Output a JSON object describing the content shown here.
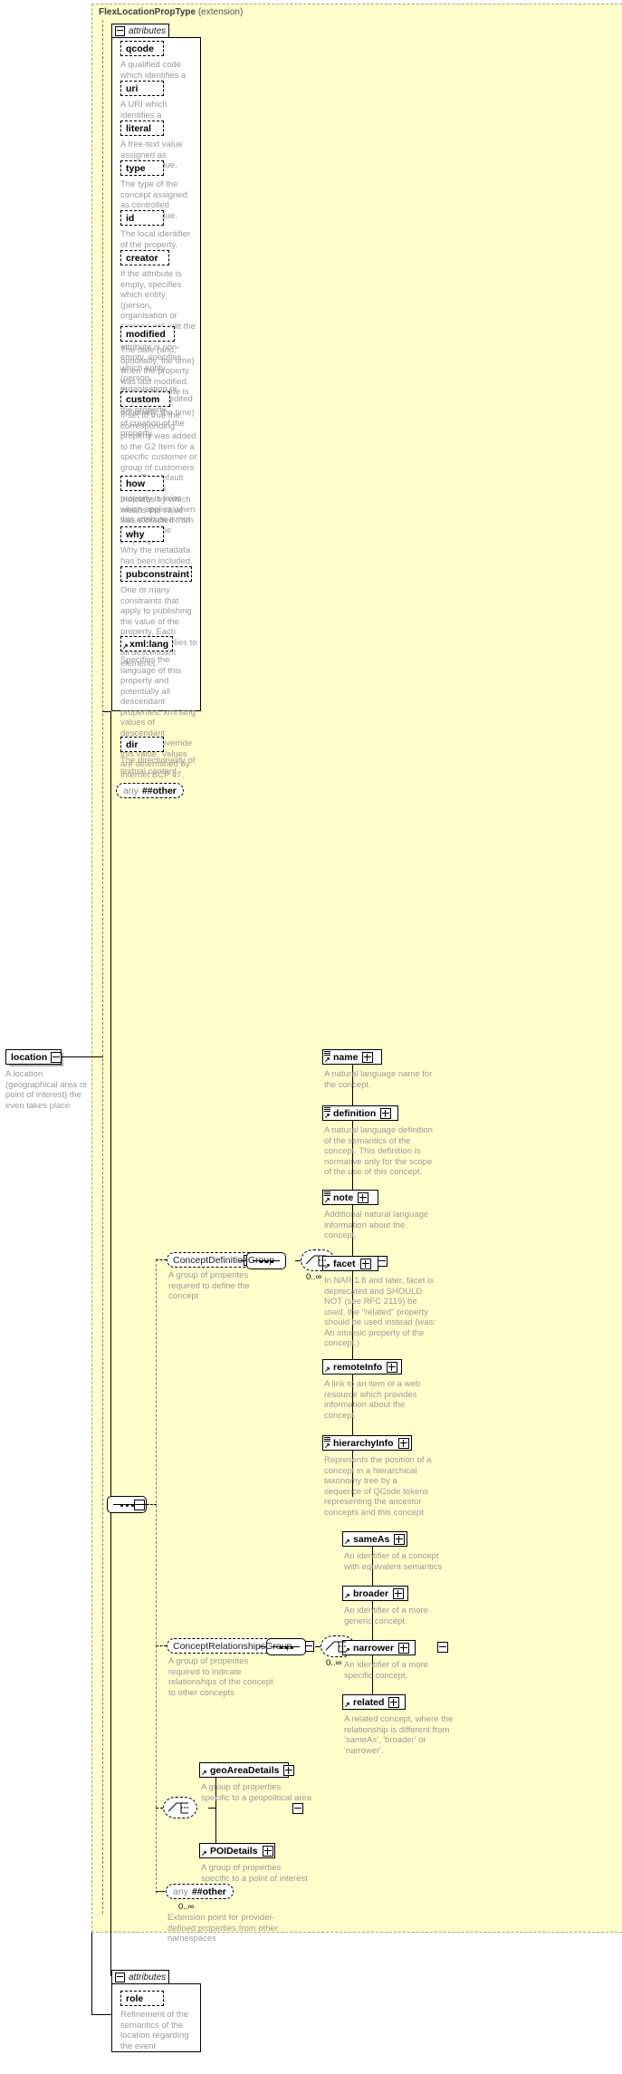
{
  "diagram": {
    "type": "xsd-schema-diagram",
    "extension_region": {
      "title_type": "FlexLocationPropType",
      "title_kind": "(extension)"
    },
    "root_element": {
      "name": "location",
      "annotation": "A location (geographical area or point of interest) the even takes place",
      "toggle": "minus"
    },
    "top_attributes": {
      "tab_label": "attributes",
      "toggle": "minus",
      "items": [
        {
          "name": "qcode",
          "desc": "A qualified code which identifies a concept."
        },
        {
          "name": "uri",
          "desc": "A URI which identifies a concept."
        },
        {
          "name": "literal",
          "desc": "A free-text value assigned as property value."
        },
        {
          "name": "type",
          "desc": "The type of the concept assigned as controlled property value."
        },
        {
          "name": "id",
          "desc": "The local identifier of the property."
        },
        {
          "name": "creator",
          "desc": "If the attribute is empty, specifies which entity (person, organisation or system) will edit the property. If the attribute is non-empty, specifies which entity (person, organisation or system) has edited the property."
        },
        {
          "name": "modified",
          "desc": "The date (and, optionally, the time) when the property was last modified. The initial value is the date (and, optionally, the time) of creation of the property."
        },
        {
          "name": "custom",
          "desc": "If set to true the corresponding property was added to the G2 Item for a specific customer or group of customers only. The default value of this property is false which applies when this attribute is not used with the property."
        },
        {
          "name": "how",
          "desc": "Indicates by which means the value was extracted from the content."
        },
        {
          "name": "why",
          "desc": "Why the metadata has been included."
        },
        {
          "name": "pubconstraint",
          "desc": "One or many constraints that apply to publishing the value of the property. Each constraint applies to all descendant elements."
        },
        {
          "name": "xml:lang",
          "desc": "Specifies the language of this property and potentially all descendant properties. xml:lang values of descendant properties override this value. Values are determined by Internet BCP 47.",
          "ref": true
        },
        {
          "name": "dir",
          "desc": "The directionality of textual content."
        }
      ],
      "any": {
        "keyword": "any",
        "namespace": "##other"
      }
    },
    "concept_definition_group": {
      "label": "ConceptDefinitionGroup",
      "desc": "A group of properites required to define the concept",
      "toggle": "minus",
      "cardinality": "0..∞",
      "children": [
        {
          "name": "name",
          "desc": "A natural language name for the concept.",
          "has_lines": true,
          "toggle": "plus"
        },
        {
          "name": "definition",
          "desc": "A natural language definition of the semantics of the concept. This definition is normative only for the scope of the use of this concept.",
          "has_lines": true,
          "toggle": "plus"
        },
        {
          "name": "note",
          "desc": "Additional natural language information about the concept.",
          "has_lines": true,
          "toggle": "plus"
        },
        {
          "name": "facet",
          "desc": "In NAR 1.8 and later, facet is deprecated and SHOULD NOT (see RFC 2119) be used, the \"related\" property should be used instead (was: An intrinsic property of the concept.)",
          "has_lines": false,
          "toggle": "plus"
        },
        {
          "name": "remoteInfo",
          "desc": "A link to an item or a web resource which provides information about the concept",
          "has_lines": false,
          "toggle": "plus"
        },
        {
          "name": "hierarchyInfo",
          "desc": "Represents the position of a concept in a hierarchical taxonomy tree by a sequence of QCode tokens representing the ancestor concepts and this concept",
          "has_lines": true,
          "toggle": "plus"
        }
      ]
    },
    "concept_relationships_group": {
      "label": "ConceptRelationshipsGroup",
      "desc": "A group of properites required to indicate relationships of the concept to other concepts",
      "toggle": "minus",
      "cardinality": "0..∞",
      "children": [
        {
          "name": "sameAs",
          "desc": "An identifier of a concept with equivalent semantics",
          "toggle": "plus"
        },
        {
          "name": "broader",
          "desc": "An identifier of a more generic concept.",
          "toggle": "plus"
        },
        {
          "name": "narrower",
          "desc": "An identifier of a more specific concept.",
          "toggle": "plus"
        },
        {
          "name": "related",
          "desc": "A related concept, where the relationship is different from 'sameAs', 'broader' or 'narrower'.",
          "toggle": "plus"
        }
      ]
    },
    "details_choice": {
      "toggle": "minus",
      "children": [
        {
          "name": "geoAreaDetails",
          "desc": "A group of properties specific to a geopolitical area",
          "toggle": "plus"
        },
        {
          "name": "POIDetails",
          "desc": "A group of properties specific to a point of interest",
          "toggle": "plus"
        }
      ]
    },
    "extension_any": {
      "keyword": "any",
      "namespace": "##other",
      "cardinality": "0..∞",
      "desc": "Extension point for provider-defined properties from other namespaces"
    },
    "bottom_attributes": {
      "tab_label": "attributes",
      "toggle": "minus",
      "items": [
        {
          "name": "role",
          "desc": "Refinement of the semantics of the location regarding the event"
        }
      ]
    }
  },
  "colors": {
    "extension_background": "#ffffcc",
    "node_background": "#ffffff",
    "description_text": "#9a9a9a",
    "line": "#000000",
    "shadow": "#b0b0b0"
  }
}
